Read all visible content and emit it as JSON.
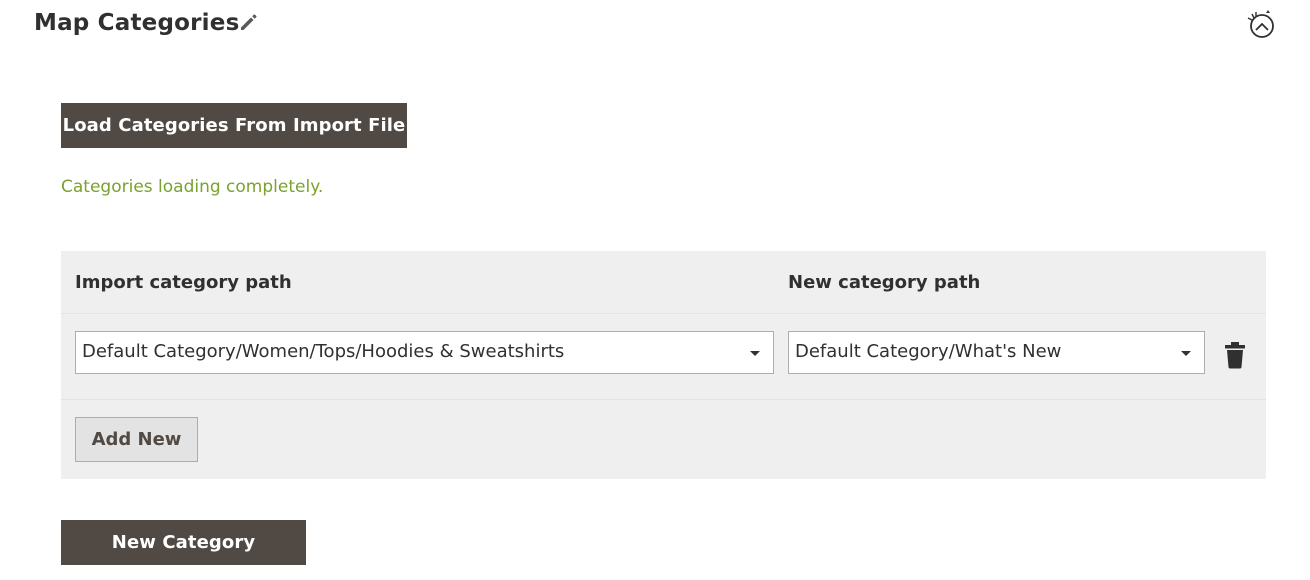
{
  "header": {
    "title": "Map Categories",
    "edit_icon": "pencil-icon",
    "history_icon": "history-clock-icon"
  },
  "actions": {
    "load_label": "Load Categories From Import File",
    "new_category_label": "New Category"
  },
  "status": {
    "message": "Categories loading completely.",
    "color": "#79a22e"
  },
  "mapping": {
    "headers": {
      "import": "Import category path",
      "new": "New category path"
    },
    "rows": [
      {
        "import_path": "Default Category/Women/Tops/Hoodies & Sweatshirts",
        "new_path": "Default Category/What's New",
        "delete_icon": "trash-icon"
      }
    ],
    "add_label": "Add New"
  },
  "colors": {
    "primary_button": "#514943",
    "table_background": "#efefef",
    "success_text": "#79a22e"
  }
}
